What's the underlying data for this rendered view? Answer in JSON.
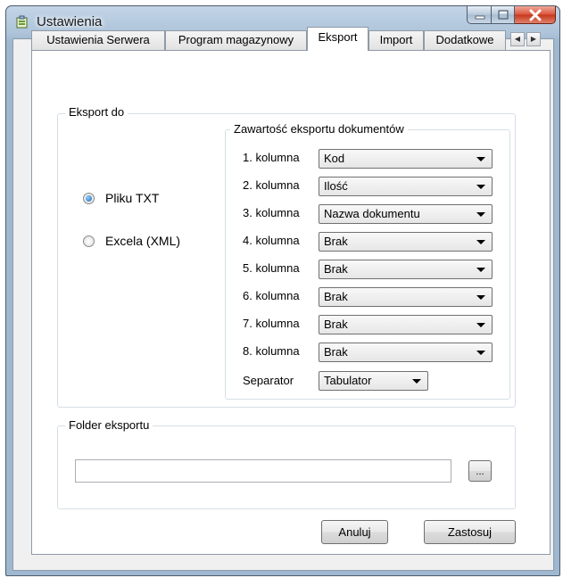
{
  "window": {
    "title": "Ustawienia"
  },
  "tabs": [
    {
      "label": "Ustawienia Serwera",
      "active": false
    },
    {
      "label": "Program magazynowy",
      "active": false
    },
    {
      "label": "Eksport",
      "active": true
    },
    {
      "label": "Import",
      "active": false
    },
    {
      "label": "Dodatkowe",
      "active": false
    }
  ],
  "export_to": {
    "title": "Eksport do",
    "options": [
      {
        "label": "Pliku TXT",
        "checked": true
      },
      {
        "label": "Excela (XML)",
        "checked": false
      }
    ]
  },
  "content": {
    "title": "Zawartość eksportu dokumentów",
    "columns": [
      {
        "label": "1. kolumna",
        "value": "Kod"
      },
      {
        "label": "2. kolumna",
        "value": "Ilość"
      },
      {
        "label": "3. kolumna",
        "value": "Nazwa dokumentu"
      },
      {
        "label": "4. kolumna",
        "value": "Brak"
      },
      {
        "label": "5. kolumna",
        "value": "Brak"
      },
      {
        "label": "6. kolumna",
        "value": "Brak"
      },
      {
        "label": "7. kolumna",
        "value": "Brak"
      },
      {
        "label": "8. kolumna",
        "value": "Brak"
      }
    ],
    "separator_label": "Separator",
    "separator_value": "Tabulator"
  },
  "folder": {
    "title": "Folder eksportu",
    "path": "",
    "browse_label": "..."
  },
  "buttons": {
    "cancel": "Anuluj",
    "apply": "Zastosuj"
  },
  "colors": {
    "active_radio": "#1b67b3",
    "close_button": "#c73619"
  }
}
